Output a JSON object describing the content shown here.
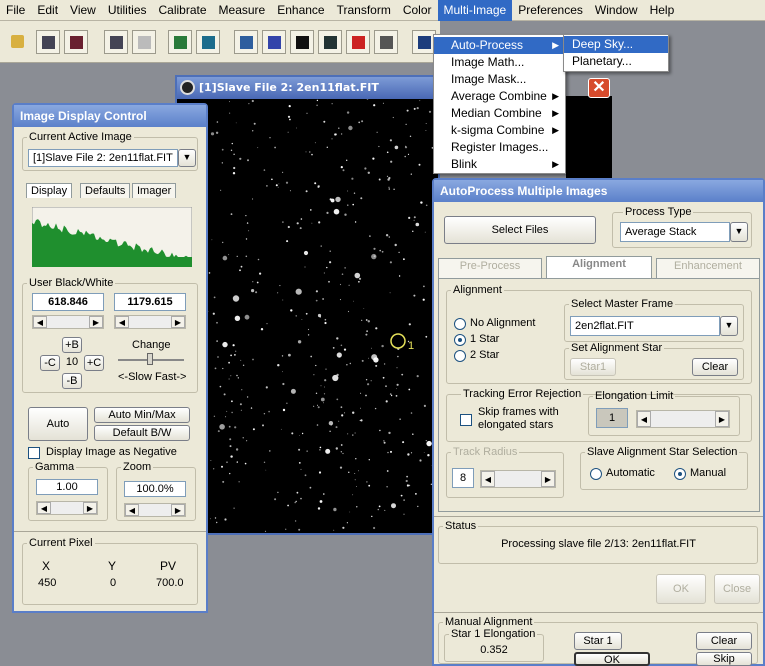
{
  "menubar": [
    "File",
    "Edit",
    "View",
    "Utilities",
    "Calibrate",
    "Measure",
    "Enhance",
    "Transform",
    "Color",
    "Multi-Image",
    "Preferences",
    "Window",
    "Help"
  ],
  "multi_image_menu": [
    {
      "label": "Auto-Process",
      "submenu": true
    },
    {
      "label": "Image Math...",
      "submenu": false
    },
    {
      "label": "Image Mask...",
      "submenu": false
    },
    {
      "label": "Average Combine",
      "submenu": true
    },
    {
      "label": "Median Combine",
      "submenu": true
    },
    {
      "label": "k-sigma Combine",
      "submenu": true
    },
    {
      "label": "Register Images...",
      "submenu": false
    },
    {
      "label": "Blink",
      "submenu": true
    }
  ],
  "auto_process_submenu": [
    "Deep Sky...",
    "Planetary..."
  ],
  "image_window": {
    "title": "[1]Slave File 2: 2en11flat.FIT",
    "marker_label": "1"
  },
  "idc": {
    "title": "Image Display Control",
    "current_active_legend": "Current Active Image",
    "current_active_value": "[1]Slave File 2: 2en11flat.FIT",
    "tabs": [
      "Display",
      "Defaults",
      "Imager"
    ],
    "user_bw_legend": "User Black/White",
    "black_value": "618.846",
    "white_value": "1179.615",
    "plus_b": "+B",
    "minus_b": "-B",
    "minus_c": "-C",
    "plus_c": "+C",
    "step_value": "10",
    "change_label": "Change",
    "slow_fast_label": "<-Slow Fast->",
    "auto_button": "Auto",
    "auto_minmax_button": "Auto Min/Max",
    "default_bw_button": "Default B/W",
    "negative_checkbox": "Display Image as Negative",
    "gamma_legend": "Gamma",
    "gamma_value": "1.00",
    "zoom_legend": "Zoom",
    "zoom_value": "100.0%",
    "current_pixel_legend": "Current Pixel",
    "pixel_headers": [
      "X",
      "Y",
      "PV"
    ],
    "pixel_values": [
      "450",
      "0",
      "700.0"
    ]
  },
  "ap": {
    "title": "AutoProcess Multiple Images",
    "select_files_button": "Select Files",
    "process_type_legend": "Process Type",
    "process_type_value": "Average Stack",
    "tabs": [
      "Pre-Process",
      "Alignment",
      "Enhancement"
    ],
    "alignment_legend": "Alignment",
    "radio_no": "No Alignment",
    "radio_1": "1 Star",
    "radio_2": "2 Star",
    "master_frame_legend": "Select Master Frame",
    "master_frame_value": "2en2flat.FIT",
    "set_star_legend": "Set Alignment Star",
    "star1_button": "Star1",
    "clear_button": "Clear",
    "tracking_legend": "Tracking Error Rejection",
    "skip_frames_label": "Skip frames with elongated stars",
    "elongation_legend": "Elongation Limit",
    "elongation_value": "1",
    "track_radius_legend": "Track Radius",
    "track_radius_value": "8",
    "slave_sel_legend": "Slave Alignment Star Selection",
    "radio_automatic": "Automatic",
    "radio_manual": "Manual",
    "status_legend": "Status",
    "status_text": "Processing slave file 2/13: 2en11flat.FIT",
    "ok_button": "OK",
    "close_button": "Close",
    "manual_legend": "Manual Alignment",
    "star1_elong_legend": "Star 1 Elongation",
    "star1_elong_value": "0.352",
    "star1_btn": "Star 1",
    "clear2_button": "Clear",
    "ok2_button": "OK",
    "skip_button": "Skip"
  },
  "colors": {
    "histogram": "#1f8f2e",
    "menu_highlight": "#316ac5",
    "title_blue": "#5b80ca"
  }
}
